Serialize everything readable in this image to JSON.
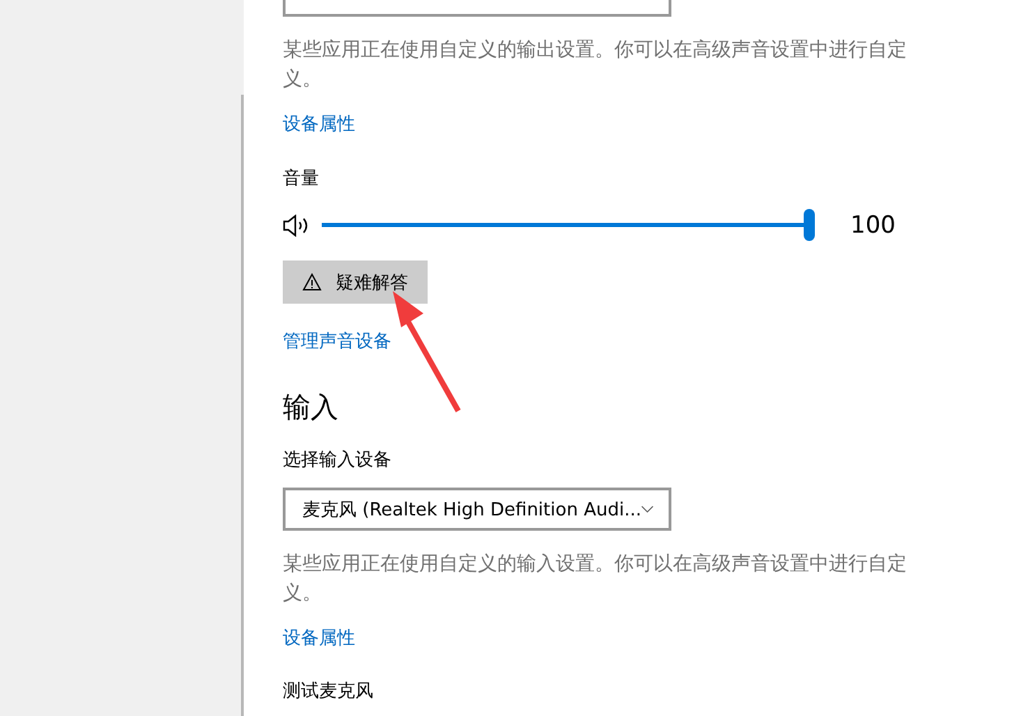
{
  "output": {
    "description": "某些应用正在使用自定义的输出设置。你可以在高级声音设置中进行自定义。",
    "properties_link": "设备属性",
    "volume": {
      "label": "音量",
      "level": 1,
      "reading": "100"
    },
    "troubleshoot_button": "疑难解答",
    "manage_link": "管理声音设备"
  },
  "input": {
    "heading": "输入",
    "select_label": "选择输入设备",
    "device": "麦克风 (Realtek High Definition Audi...",
    "description": "某些应用正在使用自定义的输入设置。你可以在高级声音设置中进行自定义。",
    "properties_link": "设备属性",
    "test_label": "测试麦克风"
  }
}
